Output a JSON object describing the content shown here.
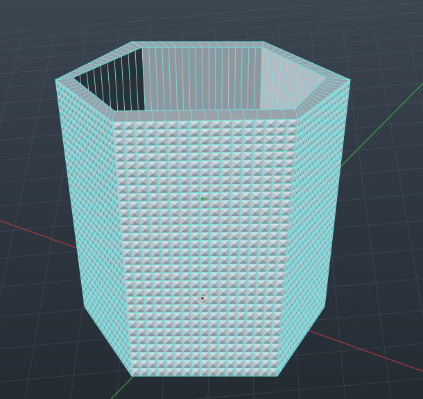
{
  "viewport": {
    "type": "3d-modeling-viewport",
    "background_top": "#3c4650",
    "background_bottom": "#242b33"
  },
  "grid": {
    "visible": true,
    "line_color": "#5a646e",
    "x_axis_color": "#b03a3a",
    "z_axis_color": "#3fa23f"
  },
  "mesh": {
    "shape": "hexagonal-prism-cup",
    "display_mode": "wireframe-on-shaded",
    "wire_color": "#6fe3e3",
    "face_color": "#a6adb5",
    "columns_per_face": 17,
    "rows": 32
  },
  "manipulator": {
    "visible": true,
    "type": "pivot"
  }
}
